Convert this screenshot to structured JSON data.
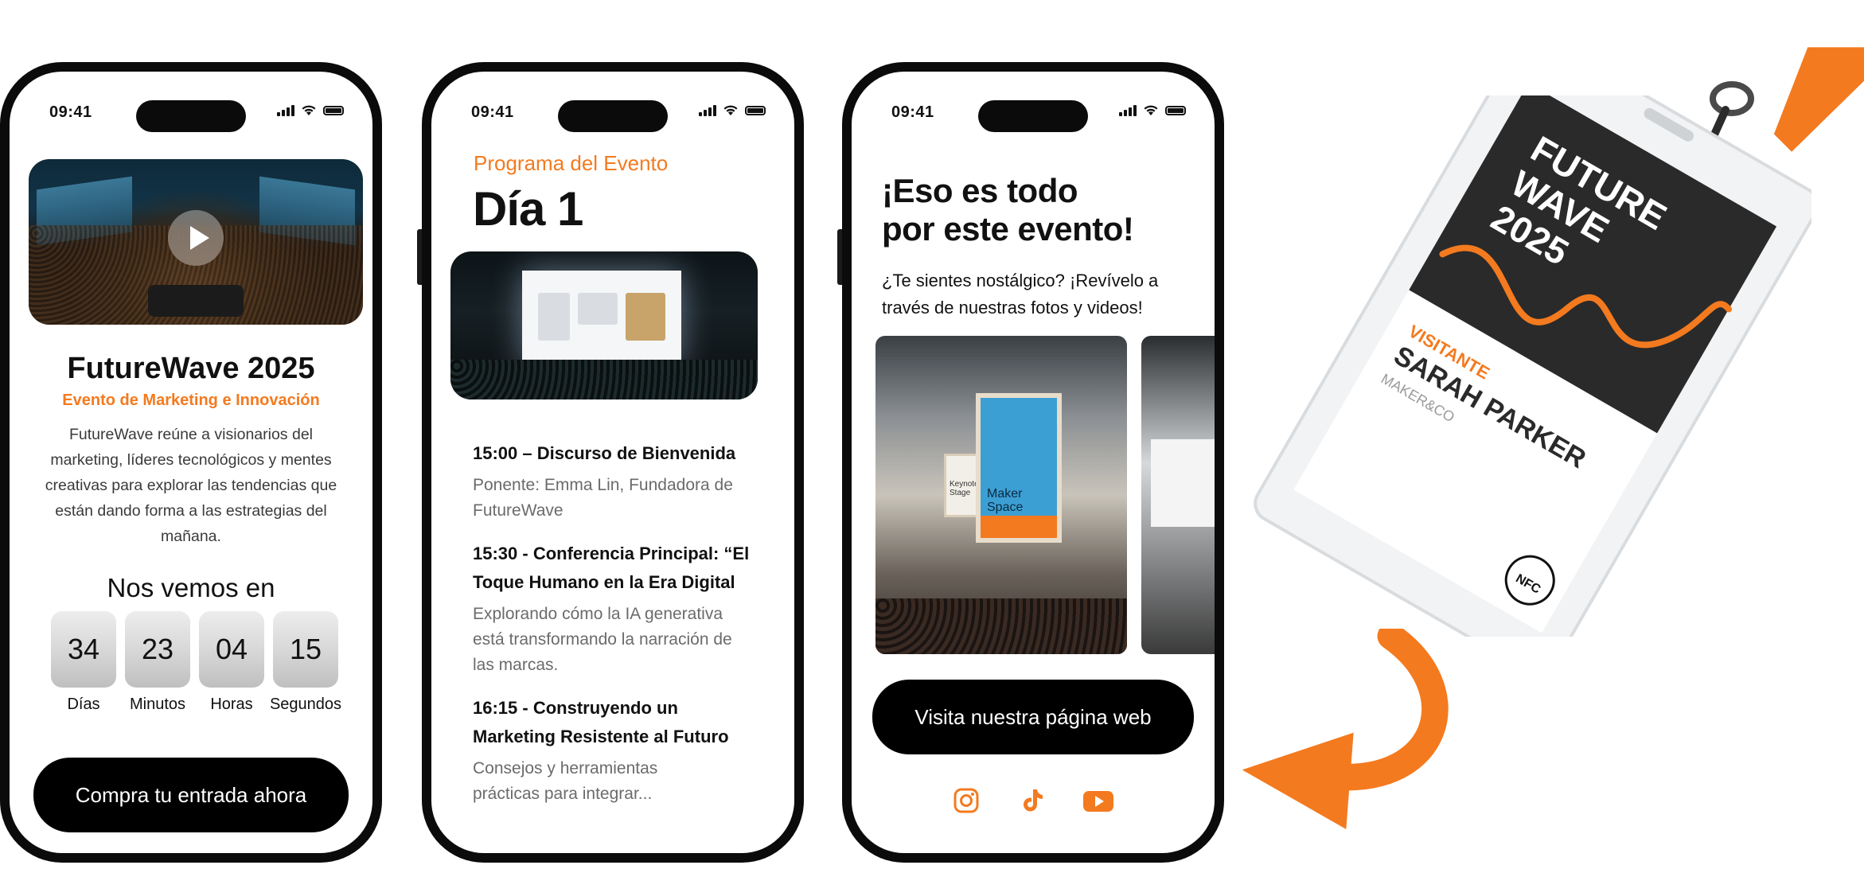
{
  "status": {
    "time": "09:41"
  },
  "phone1": {
    "title": "FutureWave 2025",
    "subtitle": "Evento de Marketing e Innovación",
    "description": "FutureWave reúne a visionarios del marketing, líderes tecnológicos y mentes creativas para explorar las tendencias que están dando forma a las estrategias del mañana.",
    "countdown_title": "Nos vemos en",
    "countdown": [
      {
        "value": "34",
        "label": "Días"
      },
      {
        "value": "23",
        "label": "Minutos"
      },
      {
        "value": "04",
        "label": "Horas"
      },
      {
        "value": "15",
        "label": "Segundos"
      }
    ],
    "cta": "Compra tu entrada ahora"
  },
  "phone2": {
    "kicker": "Programa del Evento",
    "title": "Día 1",
    "agenda": [
      {
        "heading": "15:00 – Discurso de Bienvenida",
        "detail": "Ponente: Emma Lin, Fundadora de FutureWave"
      },
      {
        "heading": "15:30 - Conferencia Principal: “El Toque Humano en la Era Digital",
        "detail": "Explorando cómo la IA generativa está transformando la narración de las marcas."
      },
      {
        "heading": "16:15 - Construyendo un Marketing Resistente al Futuro",
        "detail": "Consejos y herramientas prácticas para integrar..."
      }
    ]
  },
  "phone3": {
    "title_line1": "¡Eso es todo",
    "title_line2": "por este evento!",
    "subtitle": "¿Te sientes nostálgico? ¡Revívelo a través de nuestras fotos y videos!",
    "photo_sign": "Maker Space",
    "photo_sign_small": "Keynote Stage",
    "cta": "Visita nuestra página web",
    "socials": [
      "instagram-icon",
      "tiktok-icon",
      "youtube-icon"
    ]
  },
  "badge": {
    "title": "FUTURE WAVE 2025",
    "role": "VISITANTE",
    "name": "SARAH PARKER",
    "company": "MAKER&CO",
    "nfc": "NFC"
  },
  "colors": {
    "accent": "#f47a1f",
    "dark": "#111111"
  }
}
